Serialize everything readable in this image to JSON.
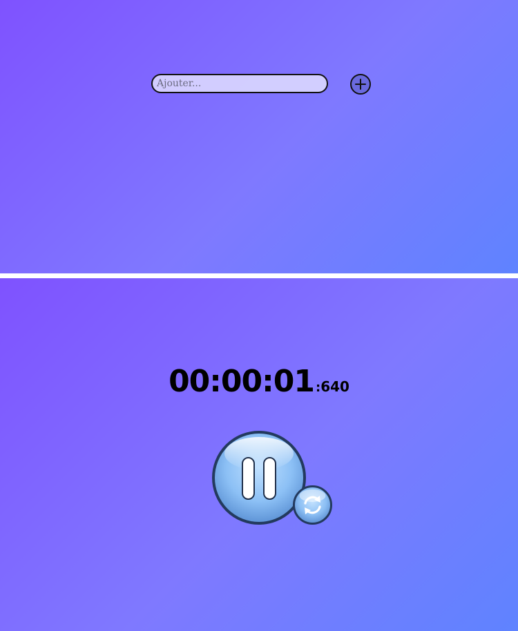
{
  "add_task": {
    "placeholder": "Ajouter...",
    "value": "",
    "button_icon": "plus-icon"
  },
  "stopwatch": {
    "hours": "00",
    "minutes": "00",
    "seconds": "01",
    "milliseconds": "640",
    "separator": ":",
    "pause_icon": "pause-icon",
    "reset_icon": "refresh-icon"
  },
  "colors": {
    "gradient_start": "#7f52ff",
    "gradient_end": "#5f83ff",
    "button_blue": "#8fc3ff",
    "button_border": "#2a4064"
  }
}
